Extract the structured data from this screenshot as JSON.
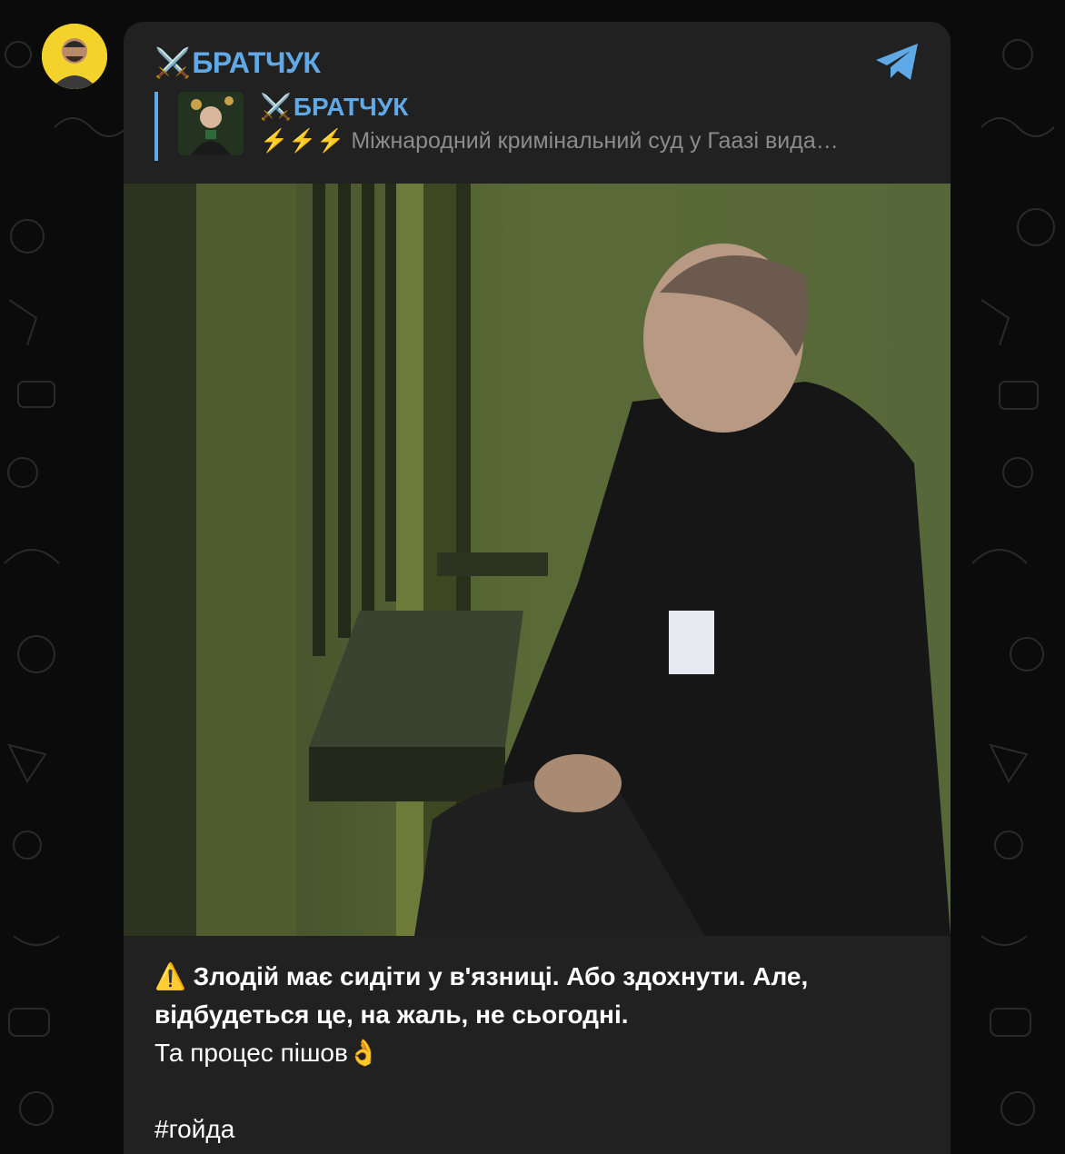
{
  "channel": {
    "name": "БРАТЧУК",
    "icon": "crossed-swords-icon",
    "accent": "#61a9e6"
  },
  "forward": {
    "name": "БРАТЧУК",
    "preview_prefix": "⚡⚡⚡",
    "preview_text": "Міжнародний кримінальний суд у Гаазі вида…"
  },
  "message": {
    "warning_icon": "⚠️",
    "line1": "Злодій має сидіти у в'язниці. Або здохнути. Але,",
    "line2": "відбудеться це, на жаль, не сьогодні.",
    "line3": "Та процес пішов",
    "line3_emoji": "👌",
    "hashtag": "#гойда"
  },
  "colors": {
    "background": "#0b0b0b",
    "card": "#212121",
    "link": "#61a9e6"
  }
}
